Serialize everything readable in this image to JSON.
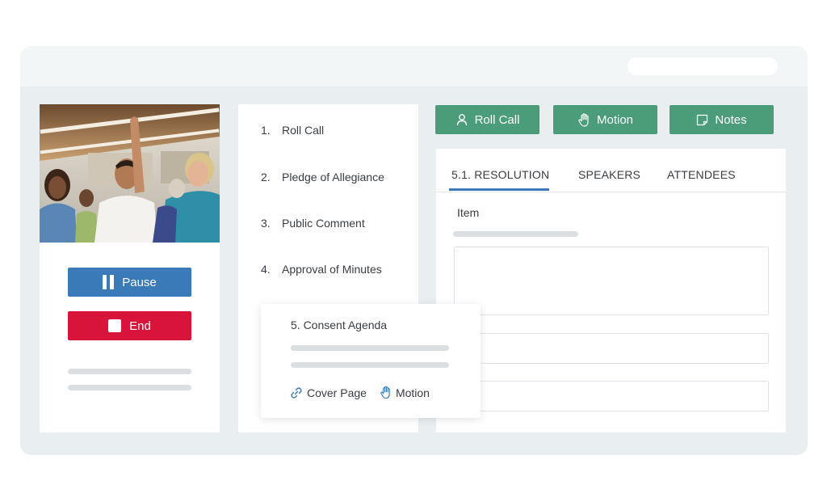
{
  "sidebar": {
    "pause_label": "Pause",
    "end_label": "End"
  },
  "agenda": {
    "items": [
      {
        "number": "1.",
        "label": "Roll Call"
      },
      {
        "number": "2.",
        "label": "Pledge of Allegiance"
      },
      {
        "number": "3.",
        "label": "Public Comment"
      },
      {
        "number": "4.",
        "label": "Approval of Minutes"
      }
    ],
    "consent": {
      "title": "5. Consent Agenda",
      "cover_page_label": "Cover Page",
      "motion_label": "Motion"
    }
  },
  "actions": {
    "roll_call_label": "Roll Call",
    "motion_label": "Motion",
    "notes_label": "Notes"
  },
  "detail": {
    "tabs": [
      {
        "label": "5.1. RESOLUTION",
        "active": true
      },
      {
        "label": "SPEAKERS",
        "active": false
      },
      {
        "label": "ATTENDEES",
        "active": false
      }
    ],
    "item_label": "Item"
  },
  "colors": {
    "accent_blue": "#3a7ab8",
    "end_red": "#d8143a",
    "action_green": "#4a9d78",
    "window_bg": "#e9eef1"
  }
}
